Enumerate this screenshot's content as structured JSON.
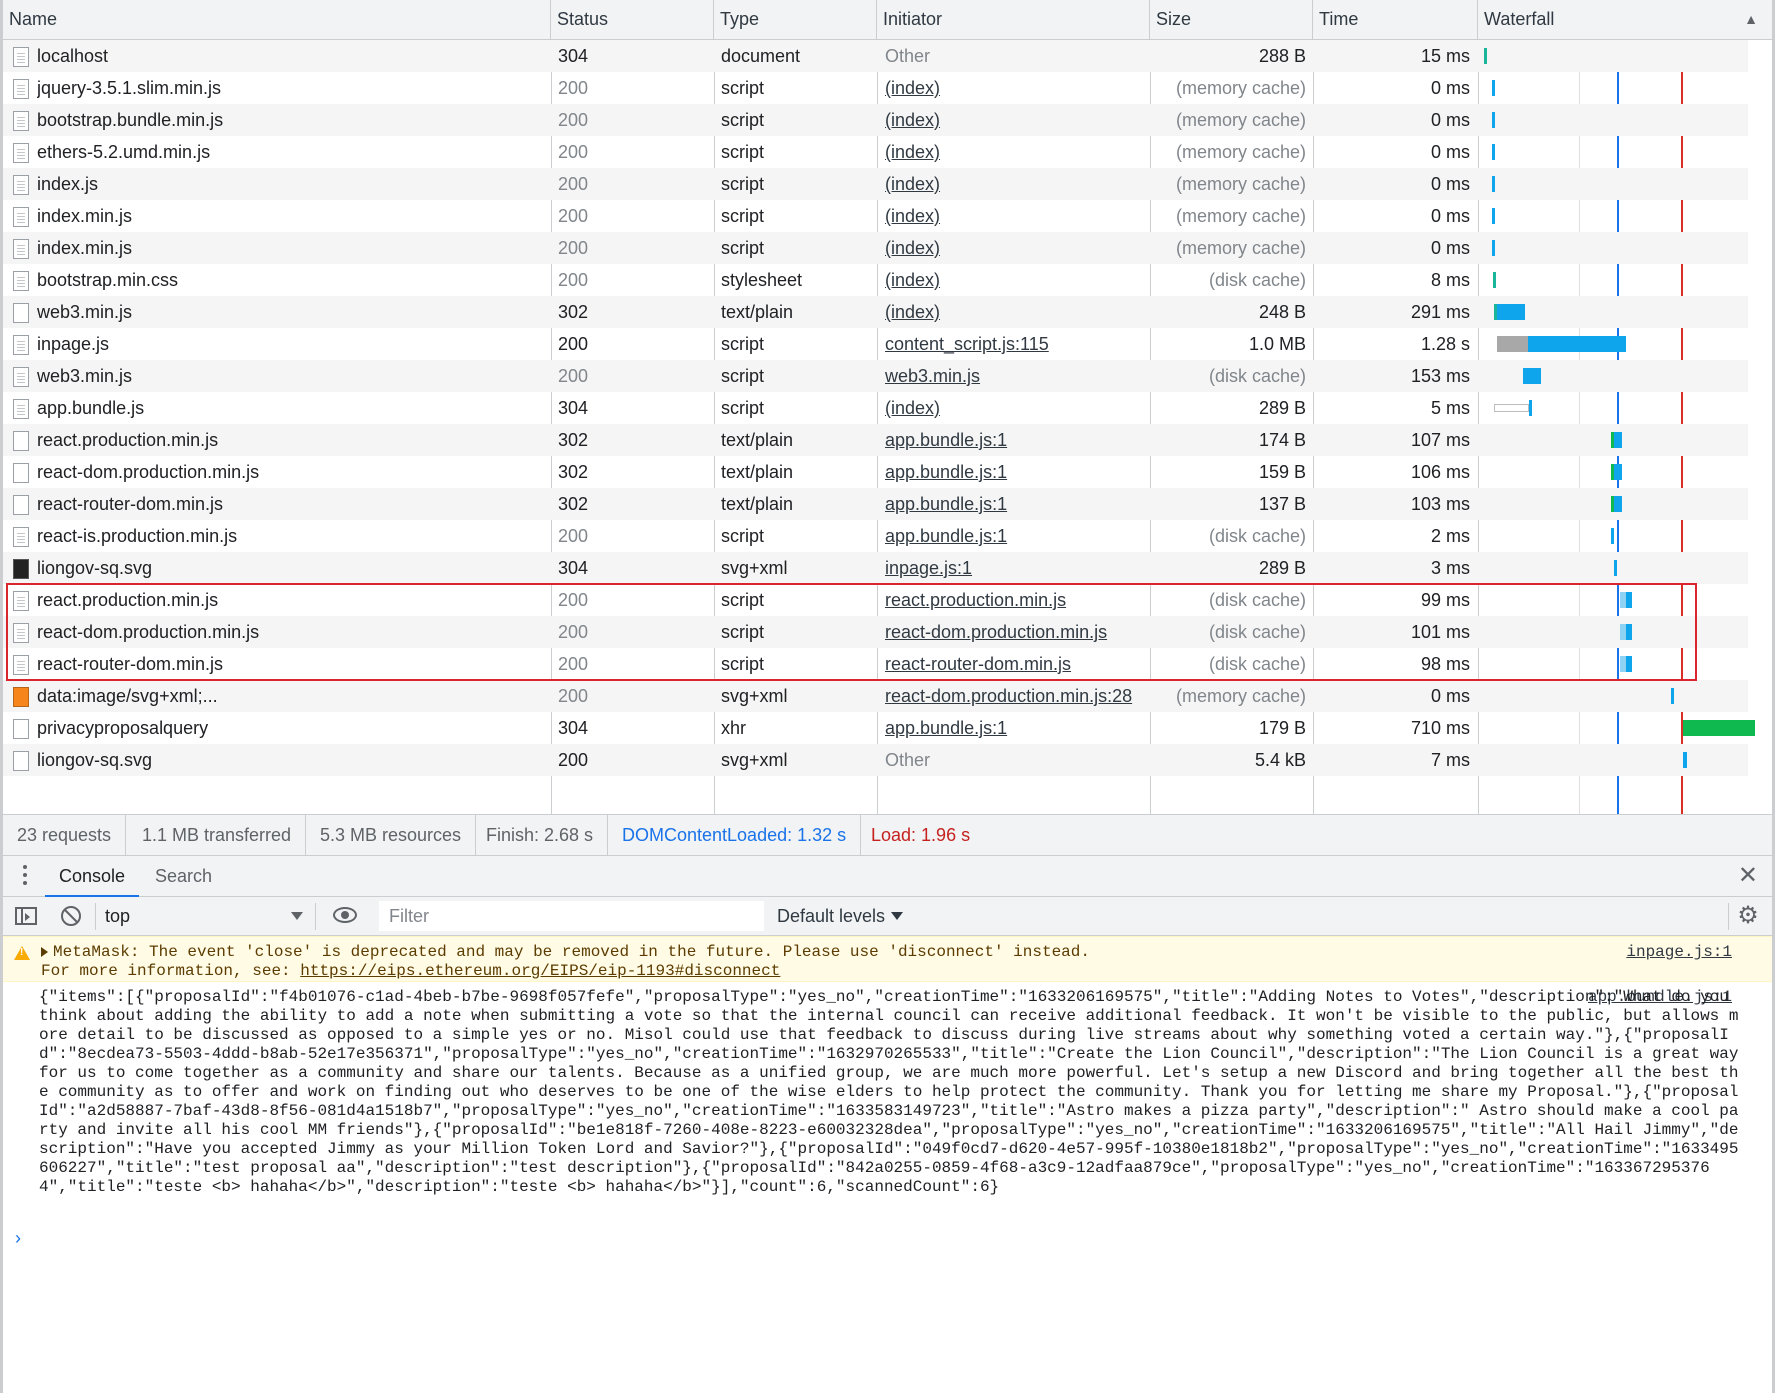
{
  "columns": {
    "name": "Name",
    "status": "Status",
    "type": "Type",
    "initiator": "Initiator",
    "size": "Size",
    "time": "Time",
    "waterfall": "Waterfall"
  },
  "requests": [
    {
      "name": "localhost",
      "status": "304",
      "type": "document",
      "initiator": "Other",
      "size": "288 B",
      "time": "15 ms",
      "icon": "doc-icon"
    },
    {
      "name": "jquery-3.5.1.slim.min.js",
      "status": "200",
      "type": "script",
      "initiator": "(index)",
      "size": "(memory cache)",
      "time": "0 ms",
      "icon": "script-icon"
    },
    {
      "name": "bootstrap.bundle.min.js",
      "status": "200",
      "type": "script",
      "initiator": "(index)",
      "size": "(memory cache)",
      "time": "0 ms",
      "icon": "script-icon"
    },
    {
      "name": "ethers-5.2.umd.min.js",
      "status": "200",
      "type": "script",
      "initiator": "(index)",
      "size": "(memory cache)",
      "time": "0 ms",
      "icon": "script-icon"
    },
    {
      "name": "index.js",
      "status": "200",
      "type": "script",
      "initiator": "(index)",
      "size": "(memory cache)",
      "time": "0 ms",
      "icon": "script-icon"
    },
    {
      "name": "index.min.js",
      "status": "200",
      "type": "script",
      "initiator": "(index)",
      "size": "(memory cache)",
      "time": "0 ms",
      "icon": "script-icon"
    },
    {
      "name": "index.min.js",
      "status": "200",
      "type": "script",
      "initiator": "(index)",
      "size": "(memory cache)",
      "time": "0 ms",
      "icon": "script-icon"
    },
    {
      "name": "bootstrap.min.css",
      "status": "200",
      "type": "stylesheet",
      "initiator": "(index)",
      "size": "(disk cache)",
      "time": "8 ms",
      "icon": "stylesheet-icon"
    },
    {
      "name": "web3.min.js",
      "status": "302",
      "type": "text/plain",
      "initiator": "(index)",
      "size": "248 B",
      "time": "291 ms",
      "icon": "file-icon"
    },
    {
      "name": "inpage.js",
      "status": "200",
      "type": "script",
      "initiator": "content_script.js:115",
      "size": "1.0 MB",
      "time": "1.28 s",
      "icon": "script-icon"
    },
    {
      "name": "web3.min.js",
      "status": "200",
      "type": "script",
      "initiator": "web3.min.js",
      "size": "(disk cache)",
      "time": "153 ms",
      "icon": "script-icon"
    },
    {
      "name": "app.bundle.js",
      "status": "304",
      "type": "script",
      "initiator": "(index)",
      "size": "289 B",
      "time": "5 ms",
      "icon": "script-icon"
    },
    {
      "name": "react.production.min.js",
      "status": "302",
      "type": "text/plain",
      "initiator": "app.bundle.js:1",
      "size": "174 B",
      "time": "107 ms",
      "icon": "file-icon"
    },
    {
      "name": "react-dom.production.min.js",
      "status": "302",
      "type": "text/plain",
      "initiator": "app.bundle.js:1",
      "size": "159 B",
      "time": "106 ms",
      "icon": "file-icon"
    },
    {
      "name": "react-router-dom.min.js",
      "status": "302",
      "type": "text/plain",
      "initiator": "app.bundle.js:1",
      "size": "137 B",
      "time": "103 ms",
      "icon": "file-icon"
    },
    {
      "name": "react-is.production.min.js",
      "status": "200",
      "type": "script",
      "initiator": "app.bundle.js:1",
      "size": "(disk cache)",
      "time": "2 ms",
      "icon": "script-icon"
    },
    {
      "name": "liongov-sq.svg",
      "status": "304",
      "type": "svg+xml",
      "initiator": "inpage.js:1",
      "size": "289 B",
      "time": "3 ms",
      "icon": "image-icon"
    },
    {
      "name": "react.production.min.js",
      "status": "200",
      "type": "script",
      "initiator": "react.production.min.js",
      "size": "(disk cache)",
      "time": "99 ms",
      "icon": "script-icon"
    },
    {
      "name": "react-dom.production.min.js",
      "status": "200",
      "type": "script",
      "initiator": "react-dom.production.min.js",
      "size": "(disk cache)",
      "time": "101 ms",
      "icon": "script-icon"
    },
    {
      "name": "react-router-dom.min.js",
      "status": "200",
      "type": "script",
      "initiator": "react-router-dom.min.js",
      "size": "(disk cache)",
      "time": "98 ms",
      "icon": "script-icon"
    },
    {
      "name": "data:image/svg+xml;...",
      "status": "200",
      "type": "svg+xml",
      "initiator": "react-dom.production.min.js:28",
      "size": "(memory cache)",
      "time": "0 ms",
      "icon": "metamask-fox-icon"
    },
    {
      "name": "privacyproposalquery",
      "status": "304",
      "type": "xhr",
      "initiator": "app.bundle.js:1",
      "size": "179 B",
      "time": "710 ms",
      "icon": "file-icon"
    },
    {
      "name": "liongov-sq.svg",
      "status": "200",
      "type": "svg+xml",
      "initiator": "Other",
      "size": "5.4 kB",
      "time": "7 ms",
      "icon": "file-icon"
    }
  ],
  "summary": {
    "requests": "23 requests",
    "transferred": "1.1 MB transferred",
    "resources": "5.3 MB resources",
    "finish": "Finish: 2.68 s",
    "domcontentloaded": "DOMContentLoaded: 1.32 s",
    "load": "Load: 1.96 s"
  },
  "drawer": {
    "tabs": [
      "Console",
      "Search"
    ],
    "active_tab": "Console",
    "context": "top",
    "filter_placeholder": "Filter",
    "levels": "Default levels"
  },
  "console": {
    "warning_line1": "MetaMask: The event 'close' is deprecated and may be removed in the future. Please use 'disconnect' instead.",
    "warning_line2_prefix": "For more information, see: ",
    "warning_link": "https://eips.ethereum.org/EIPS/eip-1193#disconnect",
    "warning_source": "inpage.js:1",
    "log_source": "app.bundle.js:1",
    "log_text": "{\"items\":[{\"proposalId\":\"f4b01076-c1ad-4beb-b7be-9698f057fefe\",\"proposalType\":\"yes_no\",\"creationTime\":\"1633206169575\",\"title\":\"Adding Notes to Votes\",\"description\":\"What do you think about adding the ability to add a note when submitting a vote so that the internal council can receive additional feedback. It won't be visible to the public, but allows more detail to be discussed as opposed to a simple yes or no. Misol could use that feedback to discuss during live streams about why something voted a certain way.\"},{\"proposalId\":\"8ecdea73-5503-4ddd-b8ab-52e17e356371\",\"proposalType\":\"yes_no\",\"creationTime\":\"1632970265533\",\"title\":\"Create the Lion Council\",\"description\":\"The Lion Council is a great way for us to come together as a community and share our talents. Because as a unified group, we are much more powerful. Let's setup a new Discord and bring together all the best the community as to offer and work on finding out who deserves to be one of the wise elders to help protect the community. Thank you for letting me share my Proposal.\"},{\"proposalId\":\"a2d58887-7baf-43d8-8f56-081d4a1518b7\",\"proposalType\":\"yes_no\",\"creationTime\":\"1633583149723\",\"title\":\"Astro makes a pizza party\",\"description\":\" Astro should make a cool party and invite all his cool MM friends\"},{\"proposalId\":\"be1e818f-7260-408e-8223-e60032328dea\",\"proposalType\":\"yes_no\",\"creationTime\":\"1633206169575\",\"title\":\"All Hail Jimmy\",\"description\":\"Have you accepted Jimmy as your Million Token Lord and Savior?\"},{\"proposalId\":\"049f0cd7-d620-4e57-995f-10380e1818b2\",\"proposalType\":\"yes_no\",\"creationTime\":\"1633495606227\",\"title\":\"test proposal aa\",\"description\":\"test description\"},{\"proposalId\":\"842a0255-0859-4f68-a3c9-12adfaa879ce\",\"proposalType\":\"yes_no\",\"creationTime\":\"1633672953764\",\"title\":\"teste <b> hahaha</b>\",\"description\":\"teste <b> hahaha</b>\"}],\"count\":6,\"scannedCount\":6}"
  },
  "colors": {
    "waterfall_blue": "#0ea5ec",
    "waterfall_gray": "#a8a8a8",
    "waterfall_green": "#0fb94f",
    "waterfall_teal": "#1ab59a",
    "dcl_line": "#1a73e8",
    "load_line": "#d93025",
    "highlight_box": "#d9252e"
  }
}
